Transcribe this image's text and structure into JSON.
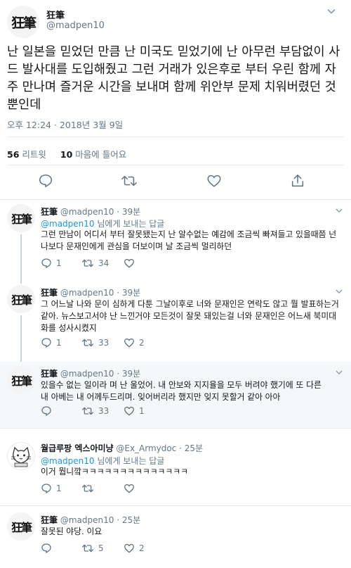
{
  "main": {
    "name": "狂筆",
    "handle": "@madpen10",
    "avatar_glyph": "狂筆",
    "text": "난 일본을 믿었던 만큼 난 미국도 믿었기에 난 아무런 부담없이 사드 발사대를 도입해줬고 그런 거래가 있은후로 부터 우린 함께 자주 만나며 즐거운 시간을 보내며 함께 위안부 문제 치워버렸던 것 뿐인데",
    "date": "오후 12:24 · 2018년 3월 9일",
    "retweets_count": "56",
    "retweets_label": "리트윗",
    "likes_count": "10",
    "likes_label": "마음에 들어요"
  },
  "replies": [
    {
      "name": "狂筆",
      "handle": "@madpen10",
      "time": "· 39분",
      "avatar_glyph": "狂筆",
      "to_mention": "@madpen10",
      "to_suffix": "님에게 보내는 답글",
      "text": "그런 만남이 어디서 부터 잘못됐는지 난 알수없는 예감에 조금씩 빠져들고 있을때쯤 넌 나보다 문재인에게 관심을 더보이며 날 조금씩 멀리하던",
      "reply_count": "1",
      "retweet_count": "34",
      "like_count": ""
    },
    {
      "name": "狂筆",
      "handle": "@madpen10",
      "time": "· 39분",
      "avatar_glyph": "狂筆",
      "text": "그 어느날 나와 문이 심하게 다툰 그날이후로 너와 문재인은 연락도 않고 뭘 발표하는거 같아. 뉴스보고서야 난 느낀거야 모든것이 잘못 돼있는걸 너와 문재인은 어느새 북미대화를 성사시켰지",
      "reply_count": "1",
      "retweet_count": "33",
      "like_count": "2"
    },
    {
      "name": "狂筆",
      "handle": "@madpen10",
      "time": "· 39분",
      "avatar_glyph": "狂筆",
      "text": "있을수 없는 일이라 며 난 울었어. 내 안보와 지지율을 모두 버려야 했기에 또 다른 내 아베는 내 어께두드리며. 잊어버리라 했지만 잊지 못할거 같아 아아",
      "reply_count": "",
      "retweet_count": "33",
      "like_count": "1"
    },
    {
      "name": "월급루팡 엑스아미냥",
      "handle": "@Ex_Armydoc",
      "time": "· 25분",
      "avatar_glyph": "",
      "to_mention": "@madpen10",
      "to_suffix": "님에게 보내는 답글",
      "text": "이거 뭡니깤ㅋㅋㅋㅋㅋㅋㅋㅋㅋㅋㅋㅋㅋㅋ",
      "reply_count": "1",
      "retweet_count": "",
      "like_count": ""
    },
    {
      "name": "狂筆",
      "handle": "@madpen10",
      "time": "· 25분",
      "avatar_glyph": "狂筆",
      "text": "잘못된 야당. 이요",
      "reply_count": "",
      "retweet_count": "5",
      "like_count": "2"
    }
  ],
  "colors": {
    "text": "#14171a",
    "muted": "#657786",
    "link": "#1b95e0",
    "border": "#e6ecf0",
    "thread": "#ccd6dd"
  },
  "icons": [
    "reply-icon",
    "retweet-icon",
    "like-icon",
    "share-icon",
    "chevron-down-icon"
  ]
}
